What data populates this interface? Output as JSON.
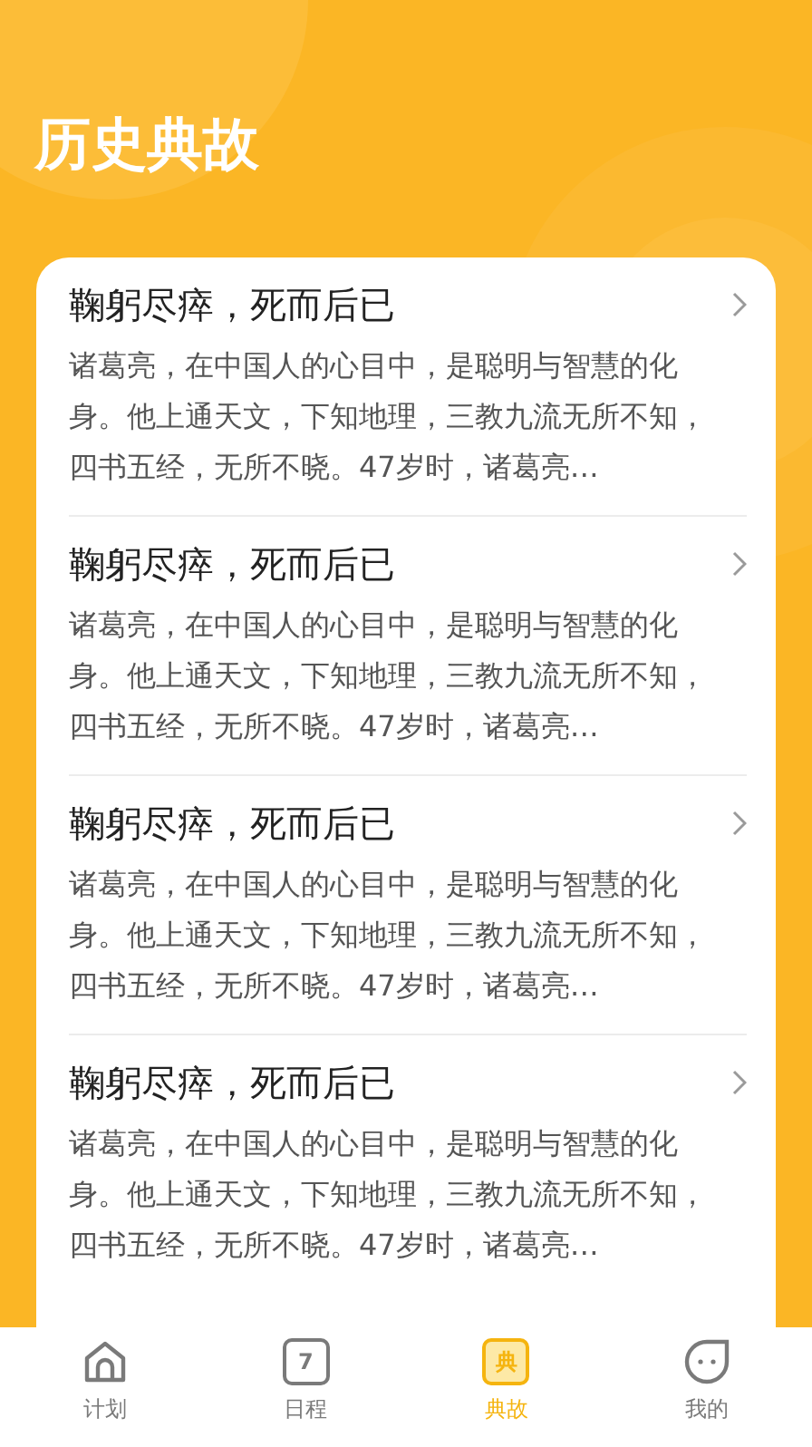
{
  "header": {
    "title": "历史典故"
  },
  "stories": [
    {
      "title": "鞠躬尽瘁，死而后已",
      "summary": "诸葛亮，在中国人的心目中，是聪明与智慧的化身。他上通天文，下知地理，三教九流无所不知，四书五经，无所不晓。47岁时，诸葛亮…"
    },
    {
      "title": "鞠躬尽瘁，死而后已",
      "summary": "诸葛亮，在中国人的心目中，是聪明与智慧的化身。他上通天文，下知地理，三教九流无所不知，四书五经，无所不晓。47岁时，诸葛亮…"
    },
    {
      "title": "鞠躬尽瘁，死而后已",
      "summary": "诸葛亮，在中国人的心目中，是聪明与智慧的化身。他上通天文，下知地理，三教九流无所不知，四书五经，无所不晓。47岁时，诸葛亮…"
    },
    {
      "title": "鞠躬尽瘁，死而后已",
      "summary": "诸葛亮，在中国人的心目中，是聪明与智慧的化身。他上通天文，下知地理，三教九流无所不知，四书五经，无所不晓。47岁时，诸葛亮…"
    }
  ],
  "tabs": [
    {
      "kind": "home",
      "label": "计划",
      "selected": false
    },
    {
      "kind": "calendar",
      "icon_text": "7",
      "label": "日程",
      "selected": false
    },
    {
      "kind": "book",
      "icon_text": "典",
      "label": "典故",
      "selected": true
    },
    {
      "kind": "chat",
      "label": "我的",
      "selected": false
    }
  ]
}
